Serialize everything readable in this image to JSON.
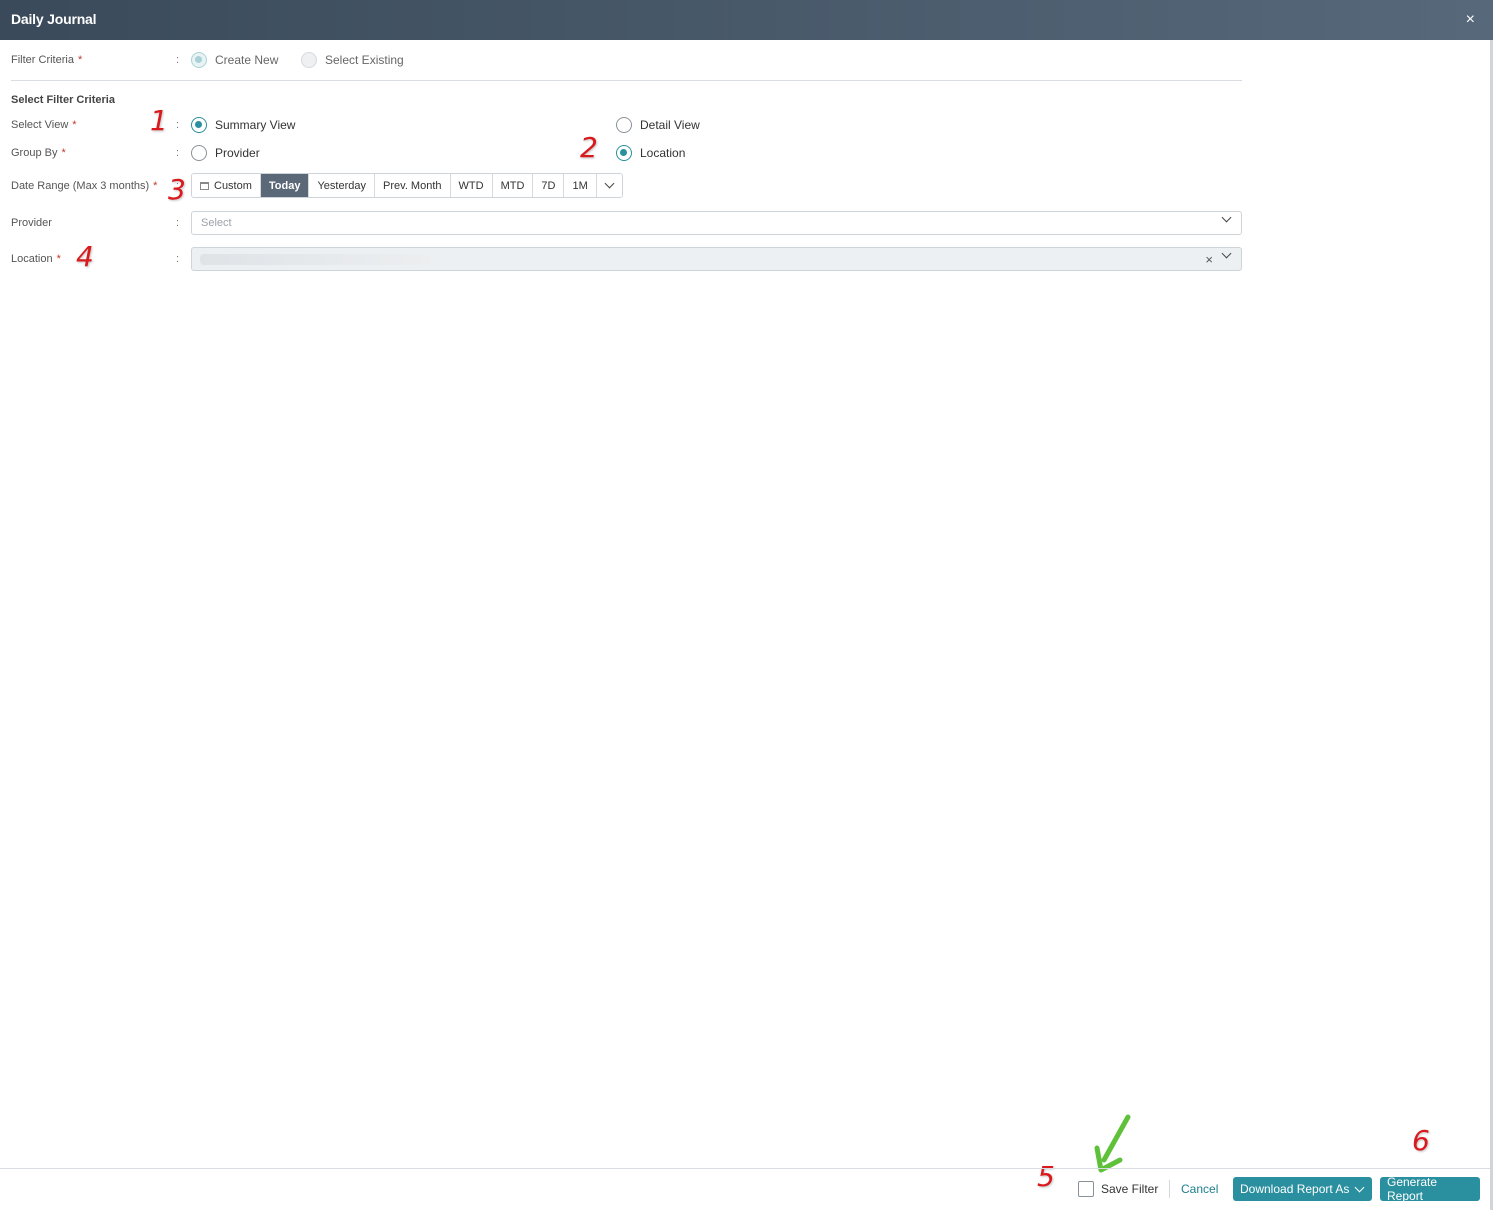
{
  "window": {
    "title": "Daily Journal",
    "close_glyph": "×"
  },
  "filter_criteria": {
    "label": "Filter Criteria",
    "required_mark": "*",
    "colon": ":",
    "options": [
      "Create New",
      "Select Existing"
    ],
    "selected": "Create New"
  },
  "section_title": "Select Filter Criteria",
  "select_view": {
    "label": "Select View",
    "required_mark": "*",
    "colon": ":",
    "options": [
      "Summary View",
      "Detail View"
    ],
    "selected": "Summary View"
  },
  "group_by": {
    "label": "Group By",
    "required_mark": "*",
    "colon": ":",
    "options": [
      "Provider",
      "Location"
    ],
    "selected": "Location"
  },
  "date_range": {
    "label": "Date Range (Max 3 months)",
    "required_mark": "*",
    "colon": ":",
    "segments": [
      "Custom",
      "Today",
      "Yesterday",
      "Prev. Month",
      "WTD",
      "MTD",
      "7D",
      "1M"
    ],
    "active": "Today"
  },
  "provider": {
    "label": "Provider",
    "colon": ":",
    "placeholder": "Select"
  },
  "location": {
    "label": "Location",
    "required_mark": "*",
    "colon": ":",
    "clear_glyph": "×"
  },
  "annotations": [
    "1",
    "2",
    "3",
    "4",
    "5",
    "6"
  ],
  "footer": {
    "save_filter_label": "Save Filter",
    "save_filter_checked": false,
    "cancel_label": "Cancel",
    "download_label": "Download Report As",
    "generate_label": "Generate Report"
  },
  "colors": {
    "accent": "#2a8f9e",
    "header": "#3a4a5a",
    "annotation": "#d9191c",
    "arrow": "#5fc13a"
  },
  "icons": [
    "close-icon",
    "calendar-icon",
    "chevron-down-icon",
    "clear-icon",
    "green-arrow-icon"
  ]
}
